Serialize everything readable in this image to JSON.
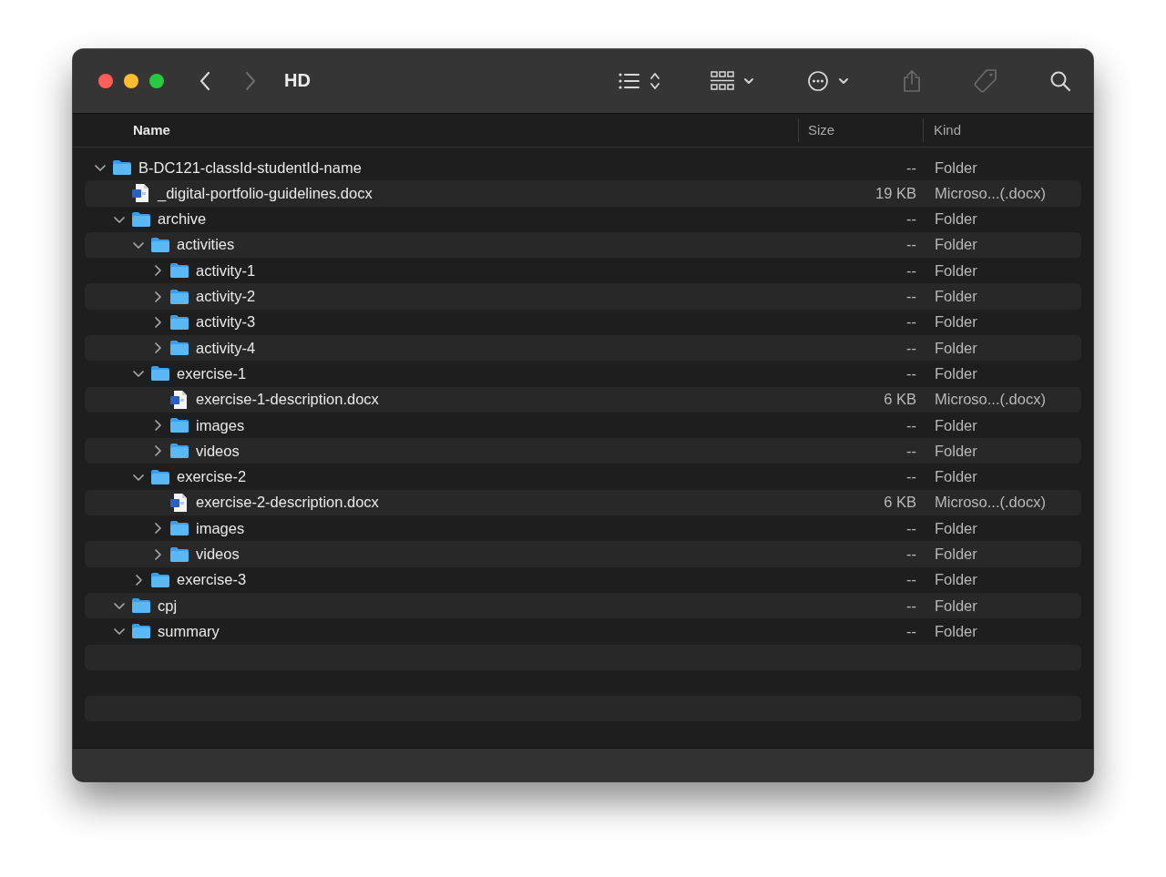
{
  "window": {
    "title": "HD"
  },
  "toolbar": [
    {
      "kind": "back",
      "disabled": false
    },
    {
      "kind": "forward",
      "disabled": true
    },
    {
      "kind": "title"
    },
    {
      "kind": "list-view",
      "disabled": false
    },
    {
      "kind": "group",
      "disabled": false
    },
    {
      "kind": "action",
      "disabled": false
    },
    {
      "kind": "share",
      "disabled": true
    },
    {
      "kind": "tag",
      "disabled": true
    },
    {
      "kind": "search",
      "disabled": false
    }
  ],
  "columns": [
    {
      "label": "Name"
    },
    {
      "label": "Size"
    },
    {
      "label": "Kind"
    }
  ],
  "tree": [
    {
      "name": "B-DC121-classId-studentId-name",
      "kind": "folder",
      "size": "--",
      "file_kind": "Folder",
      "expanded": true,
      "children": [
        {
          "name": "_digital-portfolio-guidelines.docx",
          "kind": "doc",
          "size": "19 KB",
          "file_kind": "Microso...(.docx)"
        },
        {
          "name": "archive",
          "kind": "folder",
          "size": "--",
          "file_kind": "Folder",
          "expanded": true,
          "children": [
            {
              "name": "activities",
              "kind": "folder",
              "size": "--",
              "file_kind": "Folder",
              "expanded": true,
              "children": [
                {
                  "name": "activity-1",
                  "kind": "folder",
                  "size": "--",
                  "file_kind": "Folder",
                  "expanded": false
                },
                {
                  "name": "activity-2",
                  "kind": "folder",
                  "size": "--",
                  "file_kind": "Folder",
                  "expanded": false
                },
                {
                  "name": "activity-3",
                  "kind": "folder",
                  "size": "--",
                  "file_kind": "Folder",
                  "expanded": false
                },
                {
                  "name": "activity-4",
                  "kind": "folder",
                  "size": "--",
                  "file_kind": "Folder",
                  "expanded": false
                }
              ]
            },
            {
              "name": "exercise-1",
              "kind": "folder",
              "size": "--",
              "file_kind": "Folder",
              "expanded": true,
              "children": [
                {
                  "name": "exercise-1-description.docx",
                  "kind": "doc",
                  "size": "6 KB",
                  "file_kind": "Microso...(.docx)"
                },
                {
                  "name": "images",
                  "kind": "folder",
                  "size": "--",
                  "file_kind": "Folder",
                  "expanded": false
                },
                {
                  "name": "videos",
                  "kind": "folder",
                  "size": "--",
                  "file_kind": "Folder",
                  "expanded": false
                }
              ]
            },
            {
              "name": "exercise-2",
              "kind": "folder",
              "size": "--",
              "file_kind": "Folder",
              "expanded": true,
              "children": [
                {
                  "name": "exercise-2-description.docx",
                  "kind": "doc",
                  "size": "6 KB",
                  "file_kind": "Microso...(.docx)"
                },
                {
                  "name": "images",
                  "kind": "folder",
                  "size": "--",
                  "file_kind": "Folder",
                  "expanded": false
                },
                {
                  "name": "videos",
                  "kind": "folder",
                  "size": "--",
                  "file_kind": "Folder",
                  "expanded": false
                }
              ]
            },
            {
              "name": "exercise-3",
              "kind": "folder",
              "size": "--",
              "file_kind": "Folder",
              "expanded": false
            }
          ]
        },
        {
          "name": "cpj",
          "kind": "folder",
          "size": "--",
          "file_kind": "Folder",
          "expanded": true
        },
        {
          "name": "summary",
          "kind": "folder",
          "size": "--",
          "file_kind": "Folder",
          "expanded": true
        }
      ]
    }
  ]
}
